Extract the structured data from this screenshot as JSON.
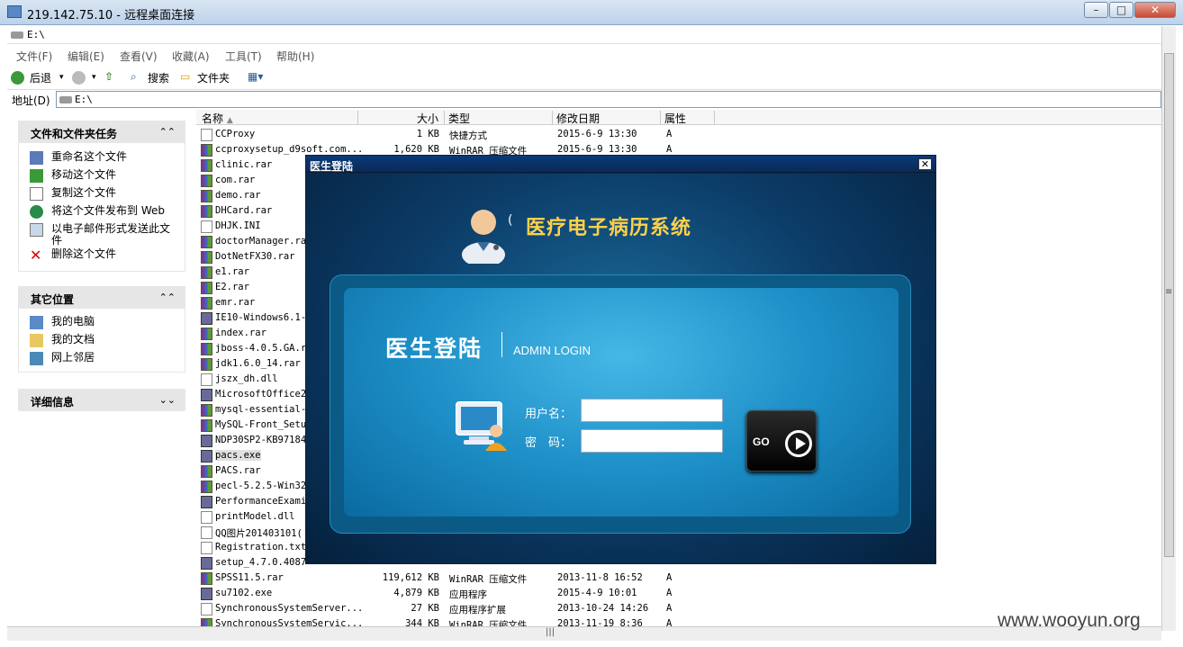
{
  "rdp": {
    "title": "219.142.75.10 - 远程桌面连接"
  },
  "explorer": {
    "title": "E:\\",
    "menu": [
      "文件(F)",
      "编辑(E)",
      "查看(V)",
      "收藏(A)",
      "工具(T)",
      "帮助(H)"
    ],
    "toolbar": {
      "back": "后退",
      "search": "搜索",
      "folders": "文件夹"
    },
    "address": {
      "label": "地址(D)",
      "value": "E:\\"
    }
  },
  "left_pane": {
    "tasks": {
      "title": "文件和文件夹任务",
      "items": [
        "重命名这个文件",
        "移动这个文件",
        "复制这个文件",
        "将这个文件发布到 Web",
        "以电子邮件形式发送此文件",
        "删除这个文件"
      ]
    },
    "places": {
      "title": "其它位置",
      "items": [
        "我的电脑",
        "我的文档",
        "网上邻居"
      ]
    },
    "details": {
      "title": "详细信息"
    }
  },
  "file_list": {
    "columns": [
      "名称",
      "大小",
      "类型",
      "修改日期",
      "属性"
    ],
    "rows": [
      {
        "name": "CCProxy",
        "size": "1 KB",
        "type": "快捷方式",
        "date": "2015-6-9 13:30",
        "attr": "A",
        "icon": "shortcut"
      },
      {
        "name": "ccproxysetup_d9soft.com...",
        "size": "1,620 KB",
        "type": "WinRAR 压缩文件",
        "date": "2015-6-9 13:30",
        "attr": "A",
        "icon": "rar"
      },
      {
        "name": "clinic.rar",
        "icon": "rar"
      },
      {
        "name": "com.rar",
        "icon": "rar"
      },
      {
        "name": "demo.rar",
        "icon": "rar"
      },
      {
        "name": "DHCard.rar",
        "icon": "rar"
      },
      {
        "name": "DHJK.INI",
        "icon": "doc"
      },
      {
        "name": "doctorManager.rar",
        "icon": "rar"
      },
      {
        "name": "DotNetFX30.rar",
        "icon": "rar"
      },
      {
        "name": "e1.rar",
        "icon": "rar"
      },
      {
        "name": "E2.rar",
        "icon": "rar"
      },
      {
        "name": "emr.rar",
        "icon": "rar"
      },
      {
        "name": "IE10-Windows6.1-:",
        "icon": "ie"
      },
      {
        "name": "index.rar",
        "icon": "rar"
      },
      {
        "name": "jboss-4.0.5.GA.r:",
        "icon": "rar"
      },
      {
        "name": "jdk1.6.0_14.rar",
        "icon": "rar"
      },
      {
        "name": "jszx_dh.dll",
        "icon": "doc"
      },
      {
        "name": "MicrosoftOffice2(",
        "icon": "exe"
      },
      {
        "name": "mysql-essential-(",
        "icon": "rar"
      },
      {
        "name": "MySQL-Front_Setup",
        "icon": "rar"
      },
      {
        "name": "NDP30SP2-KB971842",
        "icon": "exe"
      },
      {
        "name": "pacs.exe",
        "icon": "exe",
        "selected": true
      },
      {
        "name": "PACS.rar",
        "icon": "rar"
      },
      {
        "name": "pecl-5.2.5-Win32.",
        "icon": "rar"
      },
      {
        "name": "PerformanceExamin",
        "icon": "exe"
      },
      {
        "name": "printModel.dll",
        "icon": "doc"
      },
      {
        "name": "QQ图片201403101(",
        "icon": "doc"
      },
      {
        "name": "Registration.txt",
        "icon": "doc"
      },
      {
        "name": "setup_4.7.0.4087",
        "icon": "exe"
      },
      {
        "name": "SPSS11.5.rar",
        "size": "119,612 KB",
        "type": "WinRAR 压缩文件",
        "date": "2013-11-8 16:52",
        "attr": "A",
        "icon": "rar"
      },
      {
        "name": "su7102.exe",
        "size": "4,879 KB",
        "type": "应用程序",
        "date": "2015-4-9 10:01",
        "attr": "A",
        "icon": "exe"
      },
      {
        "name": "SynchronousSystemServer...",
        "size": "27 KB",
        "type": "应用程序扩展",
        "date": "2013-10-24 14:26",
        "attr": "A",
        "icon": "doc"
      },
      {
        "name": "SynchronousSystemServic...",
        "size": "344 KB",
        "type": "WinRAR 压缩文件",
        "date": "2013-11-19 8:36",
        "attr": "A",
        "icon": "rar"
      }
    ]
  },
  "dialog": {
    "title": "医生登陆",
    "close": "✕",
    "app_name": "医疗电子病历系统",
    "login_title": "医生登陆",
    "login_subtitle": "ADMIN LOGIN",
    "username_label": "用户名：",
    "password_label": "密　码：",
    "username_value": "",
    "password_value": "",
    "go_label": "GO"
  },
  "watermark": "www.wooyun.org"
}
